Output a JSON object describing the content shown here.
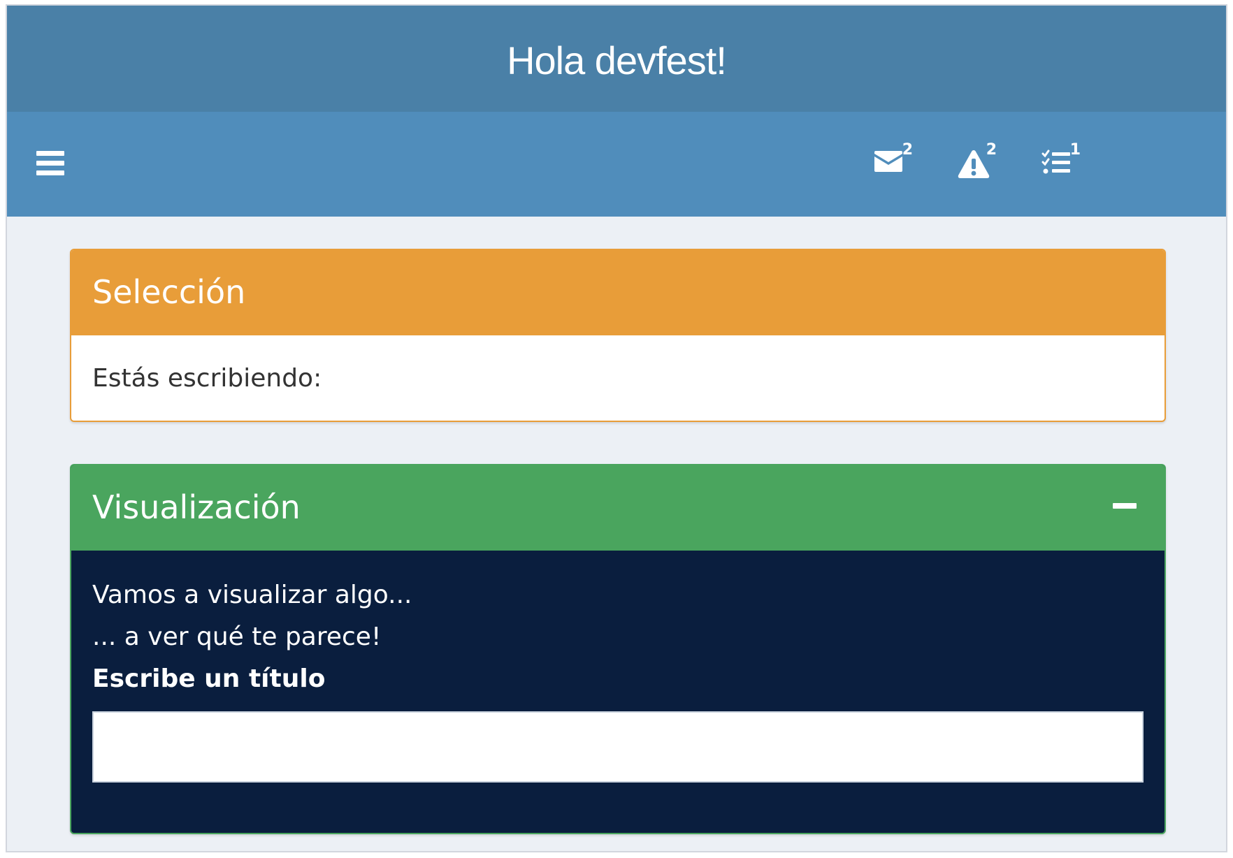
{
  "header": {
    "title": "Hola devfest!"
  },
  "navbar": {
    "menu_icon": "hamburger-menu-icon",
    "messages": {
      "icon": "envelope-icon",
      "count": "2"
    },
    "notifications": {
      "icon": "warning-triangle-icon",
      "count": "2"
    },
    "tasks": {
      "icon": "task-list-icon",
      "count": "1"
    }
  },
  "boxes": {
    "selection": {
      "title": "Selección",
      "body_text": "Estás escribiendo:",
      "color": "#e89d39"
    },
    "visualization": {
      "title": "Visualización",
      "collapse_icon": "minus-icon",
      "line1": "Vamos a visualizar algo...",
      "line2": "... a ver qué te parece!",
      "input_label": "Escribe un título",
      "input_value": "",
      "header_color": "#4aa55e",
      "body_color": "#0a1e3e"
    }
  },
  "colors": {
    "logo_bg": "#4a80a7",
    "navbar_bg": "#508dbb",
    "page_bg": "#ecf0f5"
  }
}
